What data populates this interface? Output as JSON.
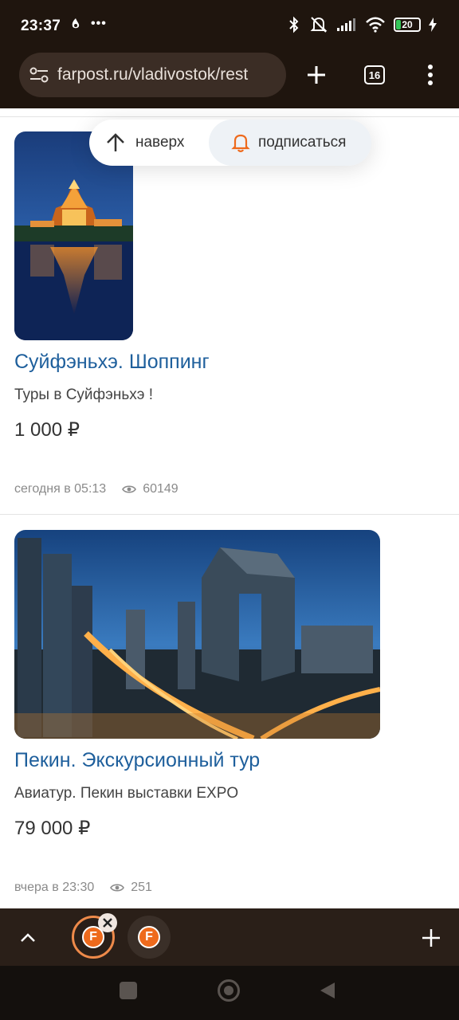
{
  "status": {
    "time": "23:37",
    "dots": "•••",
    "battery": "20",
    "battery_level": 0.2
  },
  "browser": {
    "url": "farpost.ru/vladivostok/rest",
    "tabs_count": "16"
  },
  "floating": {
    "up_label": "наверх",
    "subscribe_label": "подписаться"
  },
  "listings": [
    {
      "title": "Суйфэньхэ. Шоппинг",
      "description": "Туры в Суйфэньхэ !",
      "price": "1 000 ₽",
      "date": "сегодня в 05:13",
      "views": "60149"
    },
    {
      "title": "Пекин. Экскурсионный тур",
      "description": "Авиатур. Пекин выставки EXPO",
      "price": "79 000 ₽",
      "date": "вчера в 23:30",
      "views": "251"
    }
  ],
  "tabstrip": {
    "favicon_letter": "F"
  },
  "colors": {
    "link": "#1e5f9c",
    "accent": "#ee6a1c",
    "chrome": "#1f150e"
  }
}
